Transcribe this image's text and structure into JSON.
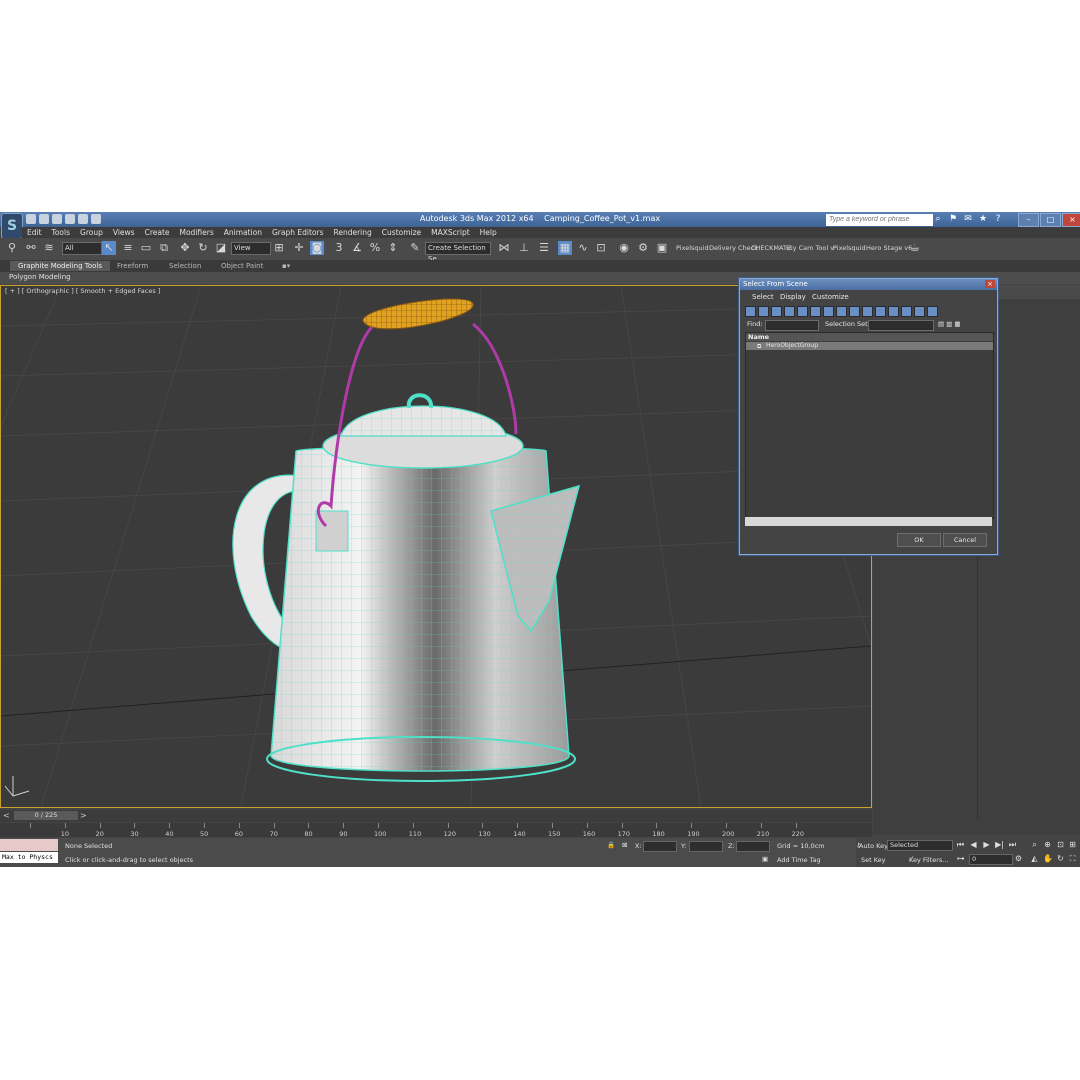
{
  "window": {
    "app_title": "Autodesk 3ds Max  2012 x64",
    "file_name": "Camping_Coffee_Pot_v1.max",
    "search_placeholder": "Type a keyword or phrase"
  },
  "menu": [
    "Edit",
    "Tools",
    "Group",
    "Views",
    "Create",
    "Modifiers",
    "Animation",
    "Graph Editors",
    "Rendering",
    "Customize",
    "MAXScript",
    "Help"
  ],
  "toolbar": {
    "selection_filter": "All",
    "ref_coord": "View",
    "named_selection": "Create Selection Se",
    "plugin_labels": [
      "Pixelsquid",
      "Delivery Check",
      "CHECKMATE",
      "uty Cam Tool v",
      "Pixelsquid",
      "Hero Stage v6"
    ]
  },
  "ribbon": {
    "tabs": [
      "Graphite Modeling Tools",
      "Freeform",
      "Selection",
      "Object Paint"
    ],
    "panel": "Polygon Modeling"
  },
  "viewport": {
    "label": "[ + ] [ Orthographic ] [ Smooth + Edged Faces ]"
  },
  "dialog": {
    "title": "Select From Scene",
    "menu": [
      "Select",
      "Display",
      "Customize"
    ],
    "find_label": "Find:",
    "selection_set_label": "Selection Set:",
    "column_name": "Name",
    "rows": [
      "HeroObjectGroup"
    ],
    "ok": "OK",
    "cancel": "Cancel"
  },
  "timeline": {
    "frame": "0 / 225",
    "ticks": [
      "0",
      "10",
      "20",
      "30",
      "40",
      "50",
      "60",
      "70",
      "80",
      "90",
      "100",
      "110",
      "120",
      "130",
      "140",
      "150",
      "160",
      "170",
      "180",
      "190",
      "200",
      "210",
      "220"
    ]
  },
  "status": {
    "script_listener": "Max to Physcs",
    "selection": "None Selected",
    "prompt": "Click or click-and-drag to select objects",
    "x_label": "X:",
    "y_label": "Y:",
    "z_label": "Z:",
    "grid": "Grid = 10,0cm",
    "add_time_tag": "Add Time Tag",
    "auto_key": "Auto Key",
    "set_key": "Set Key",
    "key_mode": "Selected",
    "key_filters": "Key Filters...",
    "current_frame": "0"
  },
  "colors": {
    "wire": "#4fe0c8",
    "handle_wire": "#b03aa8",
    "grip": "#e0a020",
    "viewport_bg": "#3b3b3b",
    "active_border": "#c9a227"
  }
}
